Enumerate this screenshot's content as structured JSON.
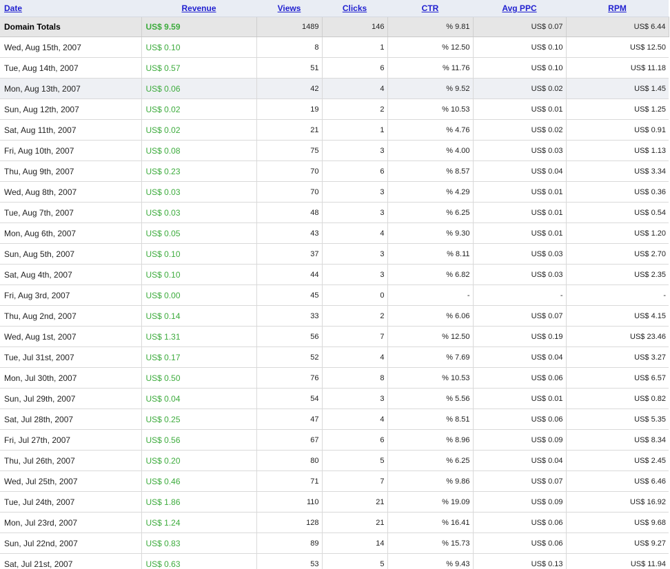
{
  "colors": {
    "header_bg": "#e9edf4",
    "link": "#1f1fd0",
    "revenue_green": "#3cab3c",
    "totals_bg": "#e6e6e6",
    "highlight_row_bg": "#eef0f4"
  },
  "headers": {
    "date": "Date",
    "revenue": "Revenue",
    "views": "Views",
    "clicks": "Clicks",
    "ctr": "CTR",
    "avg_ppc": "Avg PPC",
    "rpm": "RPM"
  },
  "totals": {
    "label": "Domain Totals",
    "revenue": "US$ 9.59",
    "views": "1489",
    "clicks": "146",
    "ctr": "% 9.81",
    "avg_ppc": "US$ 0.07",
    "rpm": "US$ 6.44"
  },
  "rows": [
    {
      "date": "Wed, Aug 15th, 2007",
      "revenue": "US$ 0.10",
      "views": "8",
      "clicks": "1",
      "ctr": "% 12.50",
      "avg_ppc": "US$ 0.10",
      "rpm": "US$ 12.50"
    },
    {
      "date": "Tue, Aug 14th, 2007",
      "revenue": "US$ 0.57",
      "views": "51",
      "clicks": "6",
      "ctr": "% 11.76",
      "avg_ppc": "US$ 0.10",
      "rpm": "US$ 11.18"
    },
    {
      "date": "Mon, Aug 13th, 2007",
      "revenue": "US$ 0.06",
      "views": "42",
      "clicks": "4",
      "ctr": "% 9.52",
      "avg_ppc": "US$ 0.02",
      "rpm": "US$ 1.45"
    },
    {
      "date": "Sun, Aug 12th, 2007",
      "revenue": "US$ 0.02",
      "views": "19",
      "clicks": "2",
      "ctr": "% 10.53",
      "avg_ppc": "US$ 0.01",
      "rpm": "US$ 1.25"
    },
    {
      "date": "Sat, Aug 11th, 2007",
      "revenue": "US$ 0.02",
      "views": "21",
      "clicks": "1",
      "ctr": "% 4.76",
      "avg_ppc": "US$ 0.02",
      "rpm": "US$ 0.91"
    },
    {
      "date": "Fri, Aug 10th, 2007",
      "revenue": "US$ 0.08",
      "views": "75",
      "clicks": "3",
      "ctr": "% 4.00",
      "avg_ppc": "US$ 0.03",
      "rpm": "US$ 1.13"
    },
    {
      "date": "Thu, Aug 9th, 2007",
      "revenue": "US$ 0.23",
      "views": "70",
      "clicks": "6",
      "ctr": "% 8.57",
      "avg_ppc": "US$ 0.04",
      "rpm": "US$ 3.34"
    },
    {
      "date": "Wed, Aug 8th, 2007",
      "revenue": "US$ 0.03",
      "views": "70",
      "clicks": "3",
      "ctr": "% 4.29",
      "avg_ppc": "US$ 0.01",
      "rpm": "US$ 0.36"
    },
    {
      "date": "Tue, Aug 7th, 2007",
      "revenue": "US$ 0.03",
      "views": "48",
      "clicks": "3",
      "ctr": "% 6.25",
      "avg_ppc": "US$ 0.01",
      "rpm": "US$ 0.54"
    },
    {
      "date": "Mon, Aug 6th, 2007",
      "revenue": "US$ 0.05",
      "views": "43",
      "clicks": "4",
      "ctr": "% 9.30",
      "avg_ppc": "US$ 0.01",
      "rpm": "US$ 1.20"
    },
    {
      "date": "Sun, Aug 5th, 2007",
      "revenue": "US$ 0.10",
      "views": "37",
      "clicks": "3",
      "ctr": "% 8.11",
      "avg_ppc": "US$ 0.03",
      "rpm": "US$ 2.70"
    },
    {
      "date": "Sat, Aug 4th, 2007",
      "revenue": "US$ 0.10",
      "views": "44",
      "clicks": "3",
      "ctr": "% 6.82",
      "avg_ppc": "US$ 0.03",
      "rpm": "US$ 2.35"
    },
    {
      "date": "Fri, Aug 3rd, 2007",
      "revenue": "US$ 0.00",
      "views": "45",
      "clicks": "0",
      "ctr": "-",
      "avg_ppc": "-",
      "rpm": "-"
    },
    {
      "date": "Thu, Aug 2nd, 2007",
      "revenue": "US$ 0.14",
      "views": "33",
      "clicks": "2",
      "ctr": "% 6.06",
      "avg_ppc": "US$ 0.07",
      "rpm": "US$ 4.15"
    },
    {
      "date": "Wed, Aug 1st, 2007",
      "revenue": "US$ 1.31",
      "views": "56",
      "clicks": "7",
      "ctr": "% 12.50",
      "avg_ppc": "US$ 0.19",
      "rpm": "US$ 23.46"
    },
    {
      "date": "Tue, Jul 31st, 2007",
      "revenue": "US$ 0.17",
      "views": "52",
      "clicks": "4",
      "ctr": "% 7.69",
      "avg_ppc": "US$ 0.04",
      "rpm": "US$ 3.27"
    },
    {
      "date": "Mon, Jul 30th, 2007",
      "revenue": "US$ 0.50",
      "views": "76",
      "clicks": "8",
      "ctr": "% 10.53",
      "avg_ppc": "US$ 0.06",
      "rpm": "US$ 6.57"
    },
    {
      "date": "Sun, Jul 29th, 2007",
      "revenue": "US$ 0.04",
      "views": "54",
      "clicks": "3",
      "ctr": "% 5.56",
      "avg_ppc": "US$ 0.01",
      "rpm": "US$ 0.82"
    },
    {
      "date": "Sat, Jul 28th, 2007",
      "revenue": "US$ 0.25",
      "views": "47",
      "clicks": "4",
      "ctr": "% 8.51",
      "avg_ppc": "US$ 0.06",
      "rpm": "US$ 5.35"
    },
    {
      "date": "Fri, Jul 27th, 2007",
      "revenue": "US$ 0.56",
      "views": "67",
      "clicks": "6",
      "ctr": "% 8.96",
      "avg_ppc": "US$ 0.09",
      "rpm": "US$ 8.34"
    },
    {
      "date": "Thu, Jul 26th, 2007",
      "revenue": "US$ 0.20",
      "views": "80",
      "clicks": "5",
      "ctr": "% 6.25",
      "avg_ppc": "US$ 0.04",
      "rpm": "US$ 2.45"
    },
    {
      "date": "Wed, Jul 25th, 2007",
      "revenue": "US$ 0.46",
      "views": "71",
      "clicks": "7",
      "ctr": "% 9.86",
      "avg_ppc": "US$ 0.07",
      "rpm": "US$ 6.46"
    },
    {
      "date": "Tue, Jul 24th, 2007",
      "revenue": "US$ 1.86",
      "views": "110",
      "clicks": "21",
      "ctr": "% 19.09",
      "avg_ppc": "US$ 0.09",
      "rpm": "US$ 16.92"
    },
    {
      "date": "Mon, Jul 23rd, 2007",
      "revenue": "US$ 1.24",
      "views": "128",
      "clicks": "21",
      "ctr": "% 16.41",
      "avg_ppc": "US$ 0.06",
      "rpm": "US$ 9.68"
    },
    {
      "date": "Sun, Jul 22nd, 2007",
      "revenue": "US$ 0.83",
      "views": "89",
      "clicks": "14",
      "ctr": "% 15.73",
      "avg_ppc": "US$ 0.06",
      "rpm": "US$ 9.27"
    },
    {
      "date": "Sat, Jul 21st, 2007",
      "revenue": "US$ 0.63",
      "views": "53",
      "clicks": "5",
      "ctr": "% 9.43",
      "avg_ppc": "US$ 0.13",
      "rpm": "US$ 11.94"
    }
  ]
}
